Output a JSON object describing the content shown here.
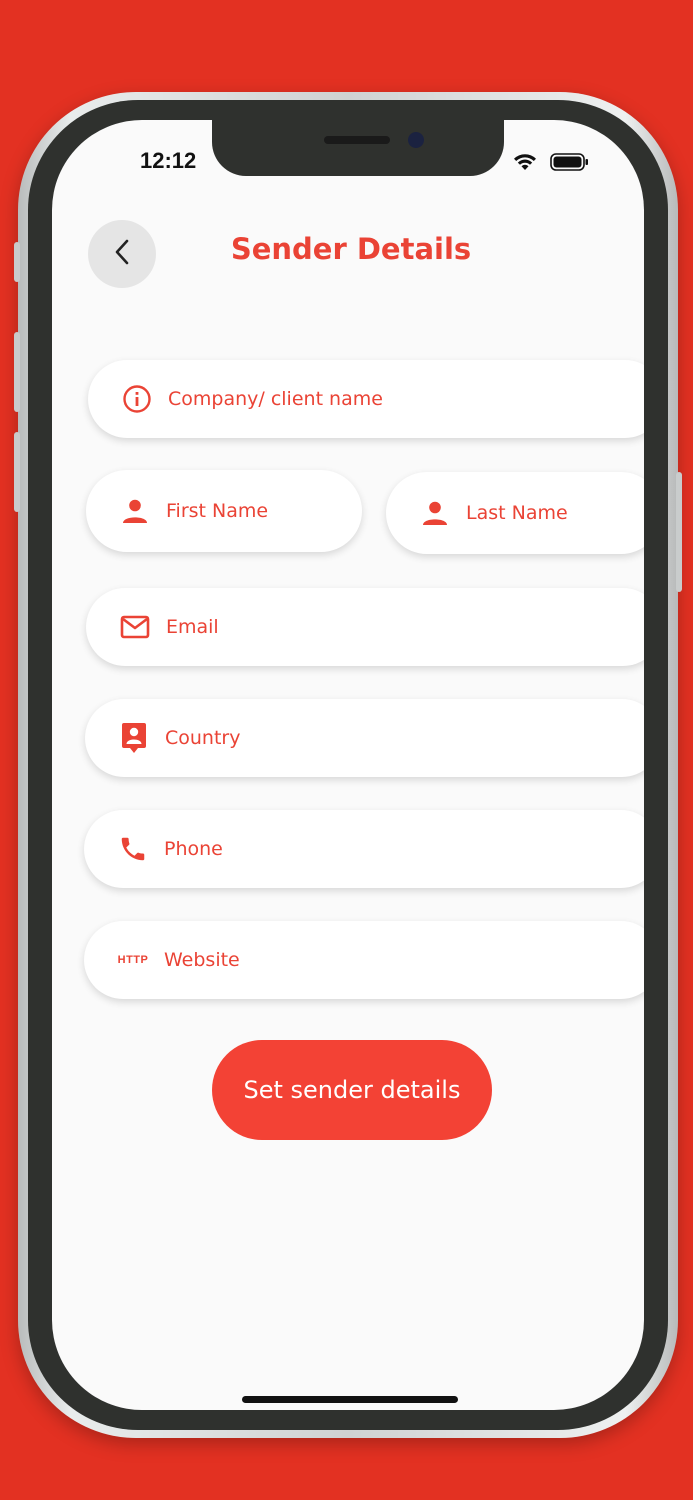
{
  "status_bar": {
    "time": "12:12",
    "icons": [
      "wifi-icon",
      "battery-icon"
    ]
  },
  "header": {
    "back_icon": "chevron-left-icon",
    "title": "Sender Details"
  },
  "form": {
    "company": {
      "placeholder": "Company/ client name",
      "icon": "info-icon"
    },
    "first_name": {
      "placeholder": "First Name",
      "icon": "person-icon"
    },
    "last_name": {
      "placeholder": "Last Name",
      "icon": "person-icon"
    },
    "email": {
      "placeholder": "Email",
      "icon": "mail-icon"
    },
    "country": {
      "placeholder": "Country",
      "icon": "contact-pin-icon"
    },
    "phone": {
      "placeholder": "Phone",
      "icon": "phone-icon"
    },
    "website": {
      "placeholder": "Website",
      "icon": "http-icon",
      "icon_text": "HTTP"
    },
    "submit_label": "Set sender details"
  },
  "colors": {
    "background": "#e33122",
    "accent": "#ea4335",
    "button": "#f34235",
    "screen": "#fafafa"
  }
}
